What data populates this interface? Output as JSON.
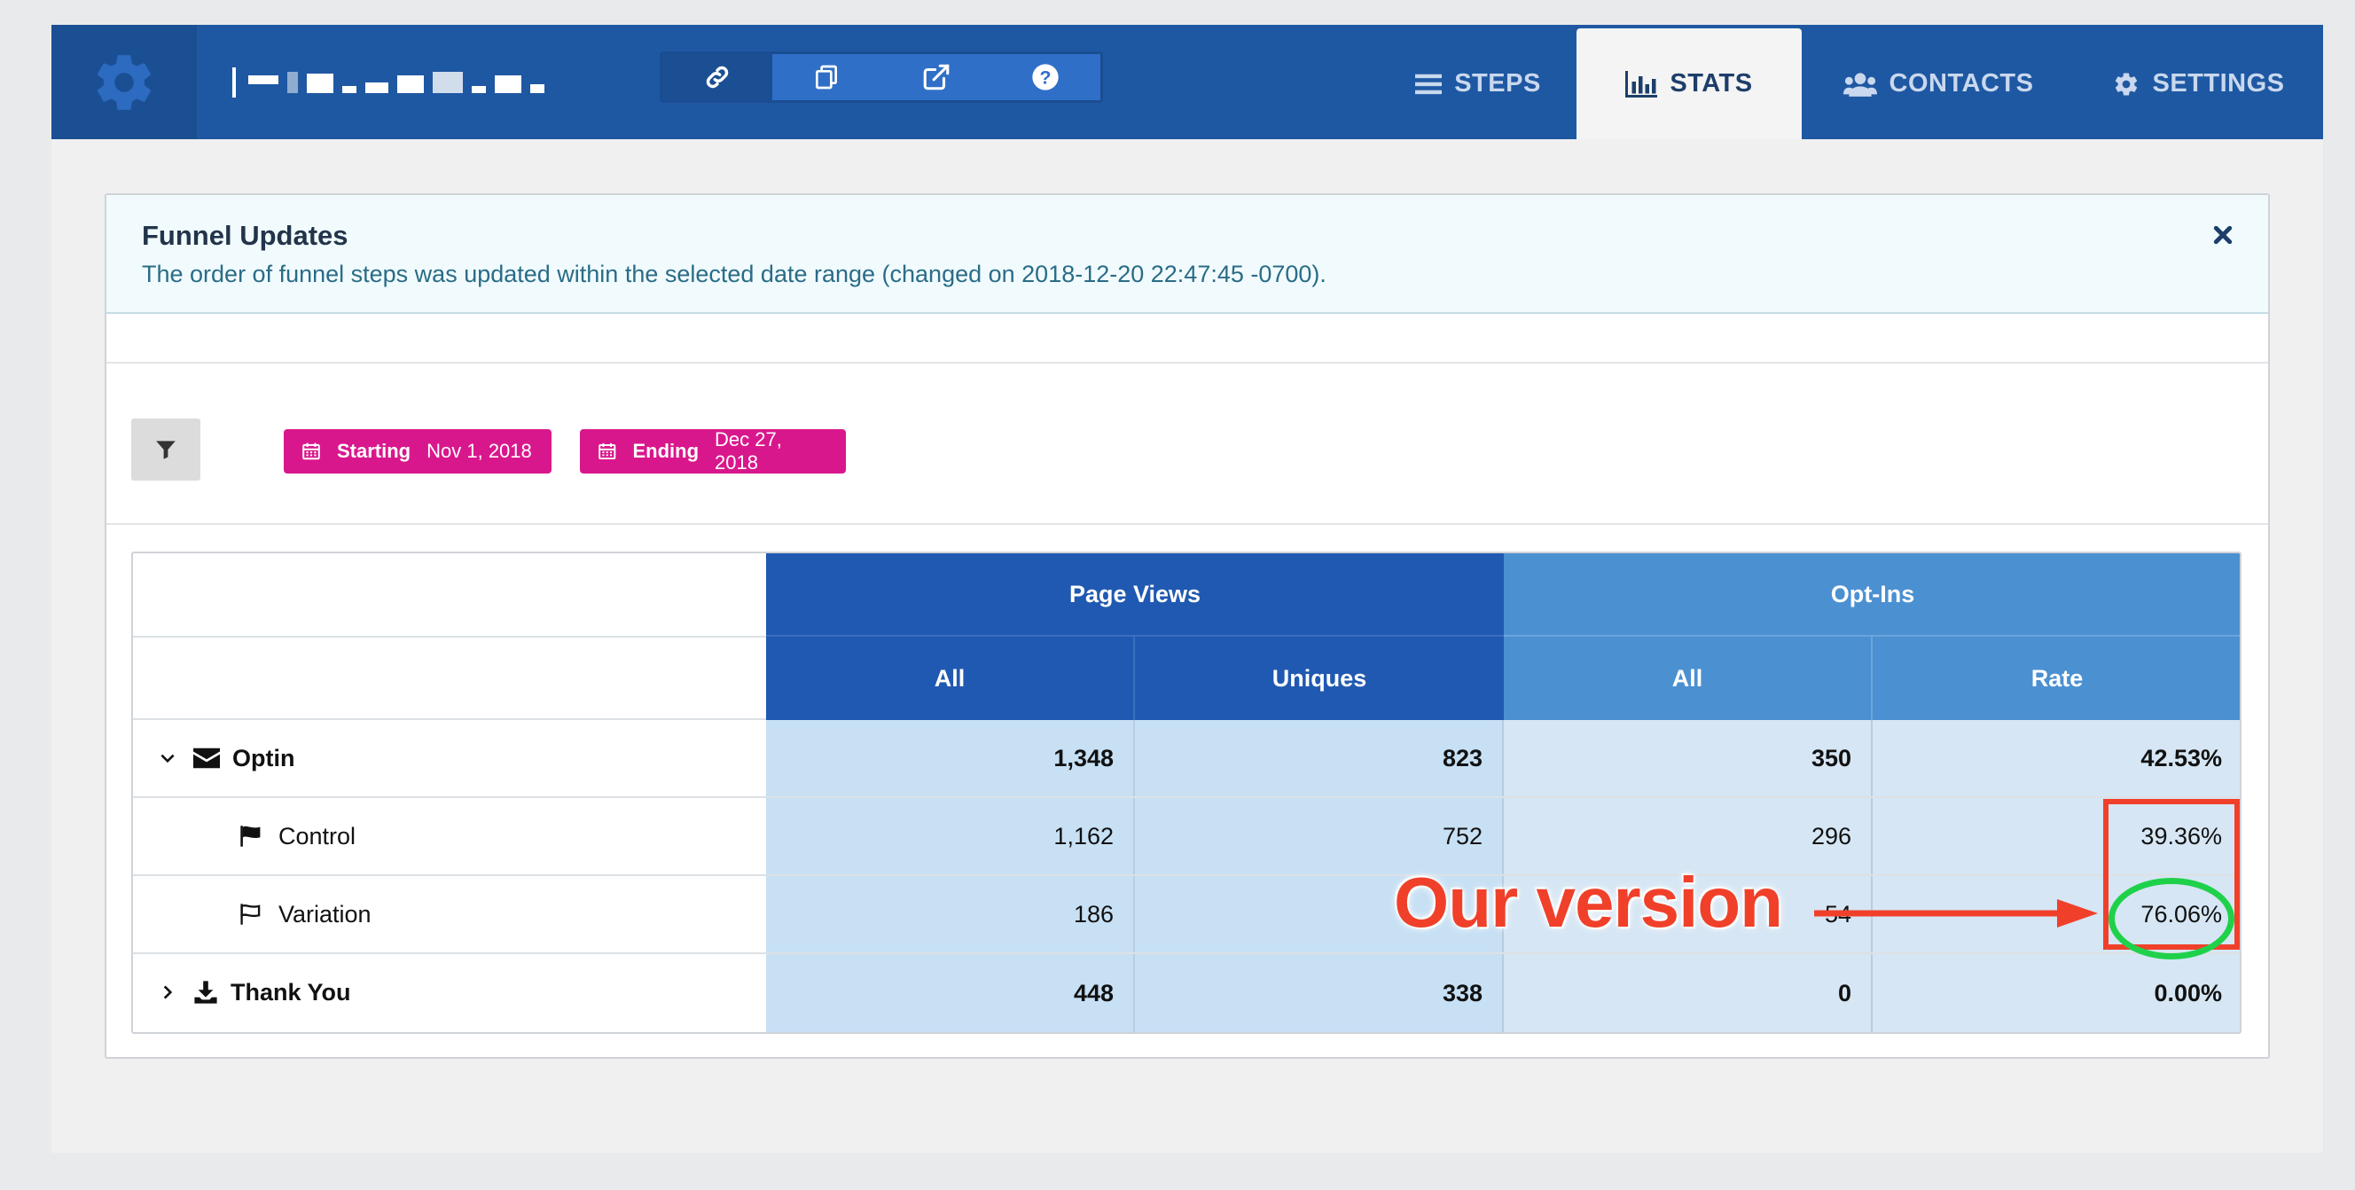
{
  "topbar": {
    "funnel_name": "",
    "tools": [
      {
        "icon": "link-icon"
      },
      {
        "icon": "copy-icon"
      },
      {
        "icon": "external-link-icon"
      },
      {
        "icon": "help-icon"
      }
    ],
    "nav": [
      {
        "label": "STEPS",
        "icon": "list-icon",
        "active": false
      },
      {
        "label": "STATS",
        "icon": "bar-chart-icon",
        "active": true
      },
      {
        "label": "CONTACTS",
        "icon": "users-icon",
        "active": false
      },
      {
        "label": "SETTINGS",
        "icon": "gear-icon",
        "active": false
      }
    ]
  },
  "alert": {
    "title": "Funnel Updates",
    "message": "The order of funnel steps was updated within the selected date range (changed on 2018-12-20 22:47:45 -0700).",
    "close_icon": "close-icon"
  },
  "filters": {
    "start_label": "Starting",
    "start_value": "Nov 1, 2018",
    "end_label": "Ending",
    "end_value": "Dec 27, 2018"
  },
  "table": {
    "groups": [
      "Page Views",
      "Opt-Ins"
    ],
    "columns": [
      "All",
      "Uniques",
      "All",
      "Rate"
    ],
    "rows": [
      {
        "name": "Optin",
        "values": [
          "1,348",
          "823",
          "350",
          "42.53%"
        ]
      },
      {
        "name": "Control",
        "values": [
          "1,162",
          "752",
          "296",
          "39.36%"
        ]
      },
      {
        "name": "Variation",
        "values": [
          "186",
          "",
          "54",
          "76.06%"
        ]
      },
      {
        "name": "Thank You",
        "values": [
          "448",
          "338",
          "0",
          "0.00%"
        ]
      }
    ]
  },
  "annotation": {
    "text": "Our version"
  },
  "colors": {
    "topbar": "#1f58a2",
    "accent_pink": "#d9178c",
    "page_views_header": "#2059b1",
    "optins_header": "#4b90d1",
    "annotation_red": "#f0402a",
    "annotation_green": "#1fd14a"
  }
}
